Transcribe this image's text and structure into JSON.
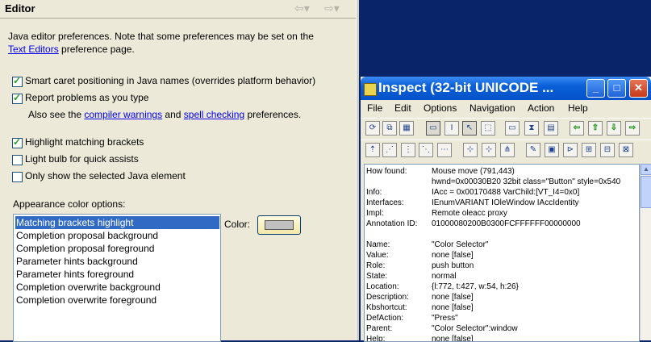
{
  "editor": {
    "title": "Editor",
    "intro_line1": "Java editor preferences. Note that some preferences may be set on the",
    "intro_link": "Text Editors",
    "intro_line2_rest": " preference page.",
    "checkboxes": [
      {
        "label": "Smart caret positioning in Java names (overrides platform behavior)",
        "checked": true
      },
      {
        "label": "Report problems as you type",
        "checked": true
      },
      {
        "label": "Highlight matching brackets",
        "checked": true
      },
      {
        "label": "Light bulb for quick assists",
        "checked": false
      },
      {
        "label": "Only show the selected Java element",
        "checked": false
      }
    ],
    "see_also_prefix": "Also see the ",
    "compiler_link": "compiler warnings",
    "see_also_and": " and ",
    "spell_link": "spell checking",
    "see_also_suffix": " preferences.",
    "appearance_label": "Appearance color options:",
    "color_options": [
      "Matching brackets highlight",
      "Completion proposal background",
      "Completion proposal foreground",
      "Parameter hints background",
      "Parameter hints foreground",
      "Completion overwrite background",
      "Completion overwrite foreground"
    ],
    "selected_option": "Matching brackets highlight",
    "color_label": "Color:",
    "swatch_color": "#c0c0c0"
  },
  "inspect": {
    "title": "Inspect  (32-bit UNICODE ...",
    "menu": [
      "File",
      "Edit",
      "Options",
      "Navigation",
      "Action",
      "Help"
    ],
    "fields": [
      {
        "key": "How found:",
        "value": "Mouse move (791,443)"
      },
      {
        "key": "",
        "value": "hwnd=0x00030B20 32bit class=\"Button\" style=0x540"
      },
      {
        "key": "Info:",
        "value": "IAcc = 0x00170488 VarChild:[VT_I4=0x0]"
      },
      {
        "key": "Interfaces:",
        "value": "IEnumVARIANT IOleWindow IAccIdentity"
      },
      {
        "key": "Impl:",
        "value": "Remote oleacc proxy"
      },
      {
        "key": "Annotation ID:",
        "value": "01000080200B0300FCFFFFFF00000000"
      },
      {
        "key": "",
        "value": ""
      },
      {
        "key": "Name:",
        "value": "\"Color Selector\""
      },
      {
        "key": "Value:",
        "value": "none [false]"
      },
      {
        "key": "Role:",
        "value": "push button"
      },
      {
        "key": "State:",
        "value": "normal"
      },
      {
        "key": "Location:",
        "value": "{l:772, t:427, w:54, h:26}"
      },
      {
        "key": "Description:",
        "value": "none [false]"
      },
      {
        "key": "Kbshortcut:",
        "value": "none [false]"
      },
      {
        "key": "DefAction:",
        "value": "\"Press\""
      },
      {
        "key": "Parent:",
        "value": "\"Color Selector\":window"
      },
      {
        "key": "Help:",
        "value": "none [false]"
      }
    ]
  }
}
